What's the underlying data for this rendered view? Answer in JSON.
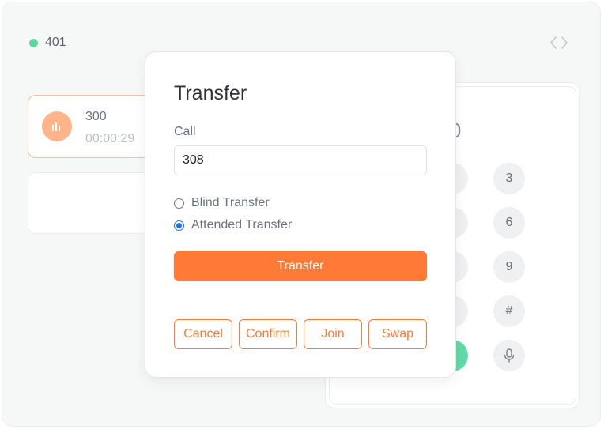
{
  "extension": {
    "number": "401",
    "status_color": "#5fd6a2"
  },
  "call_card": {
    "number": "300",
    "duration": "00:00:29",
    "accent": "#ffb48a"
  },
  "keypad": {
    "display": "300",
    "keys": [
      "3",
      "6",
      "9",
      "#"
    ],
    "mic_icon": "microphone-icon",
    "call_button_color": "#5fdba8"
  },
  "modal": {
    "title": "Transfer",
    "call_label": "Call",
    "call_value": "308",
    "options": [
      {
        "label": "Blind Transfer",
        "checked": false
      },
      {
        "label": "Attended Transfer",
        "checked": true
      }
    ],
    "transfer_button": "Transfer",
    "actions": [
      "Cancel",
      "Confirm",
      "Join",
      "Swap"
    ]
  },
  "colors": {
    "accent": "#ff7a36",
    "radio_selected": "#1a73e8"
  }
}
